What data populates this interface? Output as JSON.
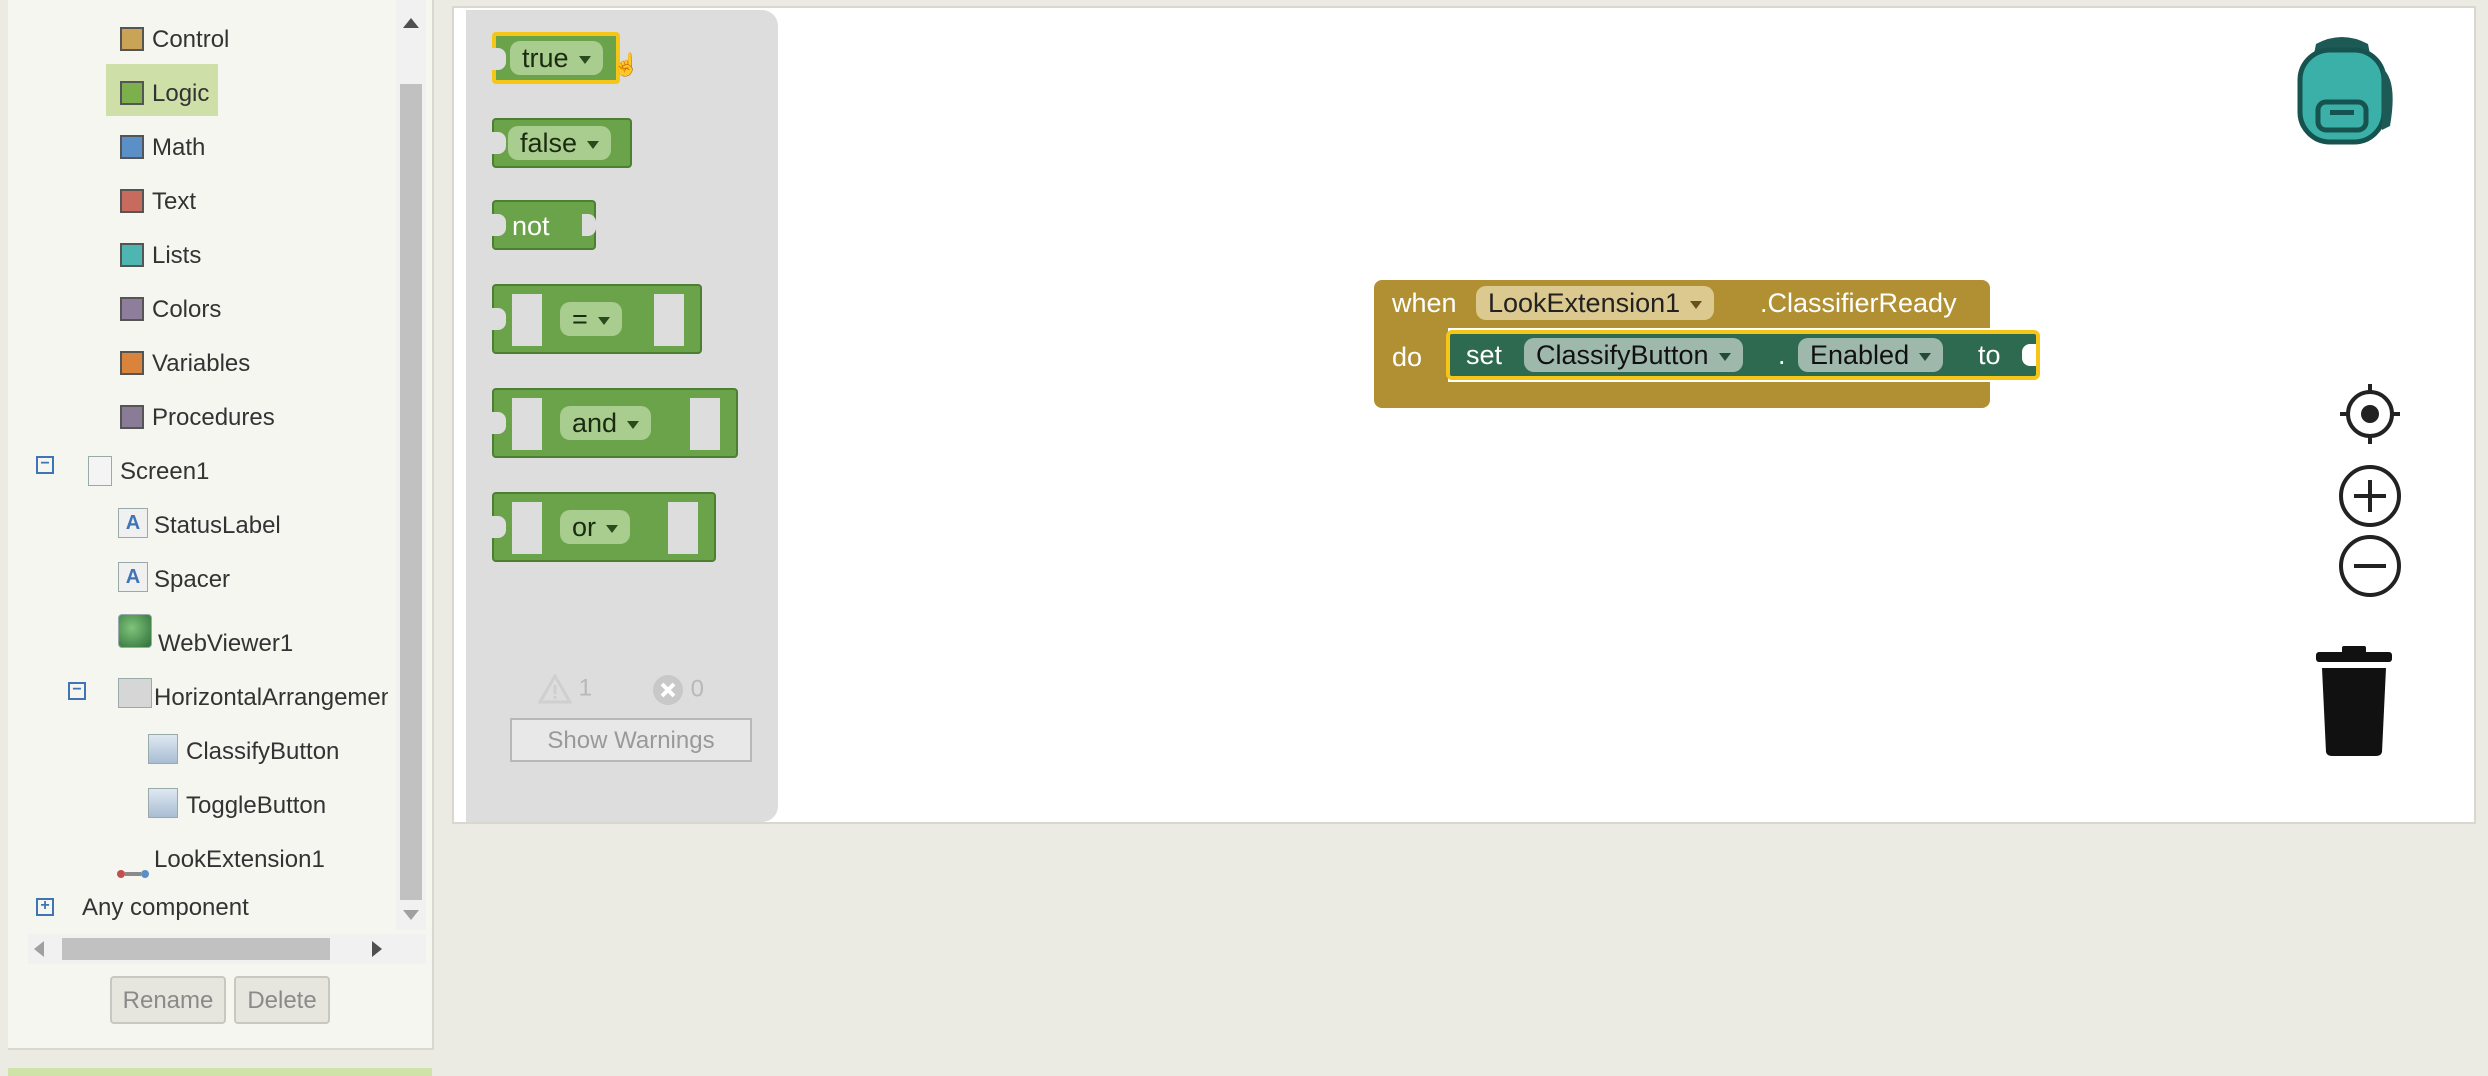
{
  "tree": {
    "builtin": [
      {
        "label": "Control",
        "color": "#c9a456"
      },
      {
        "label": "Logic",
        "color": "#7bb04c"
      },
      {
        "label": "Math",
        "color": "#5b8fc8"
      },
      {
        "label": "Text",
        "color": "#c76b5f"
      },
      {
        "label": "Lists",
        "color": "#4db6b0"
      },
      {
        "label": "Colors",
        "color": "#8e7d9b"
      },
      {
        "label": "Variables",
        "color": "#d9843a"
      },
      {
        "label": "Procedures",
        "color": "#8a7b96"
      }
    ],
    "screen": "Screen1",
    "components": {
      "status_label": "StatusLabel",
      "spacer": "Spacer",
      "webviewer": "WebViewer1",
      "horizontal_arrangement": "HorizontalArrangemen",
      "classify_button": "ClassifyButton",
      "toggle_button": "ToggleButton",
      "look_extension": "LookExtension1"
    },
    "any_component": "Any component",
    "collapse_symbol": "−",
    "expand_symbol": "+",
    "rename_label": "Rename",
    "delete_label": "Delete"
  },
  "flyout": {
    "true_label": "true",
    "false_label": "false",
    "not_label": "not",
    "eq_label": "=",
    "and_label": "and",
    "or_label": "or",
    "warning_count": "1",
    "error_count": "0",
    "show_warnings_label": "Show Warnings"
  },
  "event_block": {
    "when_label": "when",
    "component": "LookExtension1",
    "event": ".ClassifierReady",
    "do_label": "do",
    "set_label": "set",
    "target_component": "ClassifyButton",
    "dot": ".",
    "property": "Enabled",
    "to_label": "to"
  },
  "colors": {
    "logic_block": "#6aa34a",
    "event_block": "#b09032",
    "setter_block": "#2d6a4f",
    "selection": "#f5c518"
  },
  "icons": [
    "backpack-icon",
    "center-target-icon",
    "zoom-in-icon",
    "zoom-out-icon",
    "trash-icon"
  ]
}
